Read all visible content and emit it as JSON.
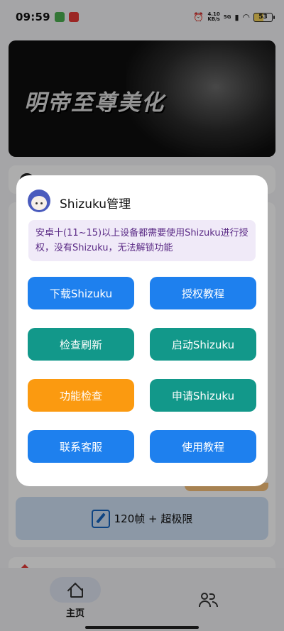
{
  "status_bar": {
    "time": "09:59",
    "net_speed": "4.10",
    "net_unit": "KB/s",
    "signal_label": "5G",
    "battery": "53"
  },
  "banner": {
    "title": "明帝至尊美化"
  },
  "mode_button": {
    "label": "120帧 + 超极限"
  },
  "dialog": {
    "title": "Shizuku管理",
    "notice": "安卓十(11~15)以上设备都需要使用Shizuku进行授权，没有Shizuku，无法解锁功能",
    "buttons": {
      "download": "下载Shizuku",
      "auth_tutorial": "授权教程",
      "refresh": "检查刷新",
      "start": "启动Shizuku",
      "feature_check": "功能检查",
      "request": "申请Shizuku",
      "support": "联系客服",
      "usage_tutorial": "使用教程"
    }
  },
  "bottom_nav": {
    "home_label": "主页"
  },
  "colors": {
    "blue": "#1e80ee",
    "teal": "#12988a",
    "orange": "#fb9a10",
    "notice_bg": "#f0eaf8",
    "notice_text": "#5b2b86"
  }
}
